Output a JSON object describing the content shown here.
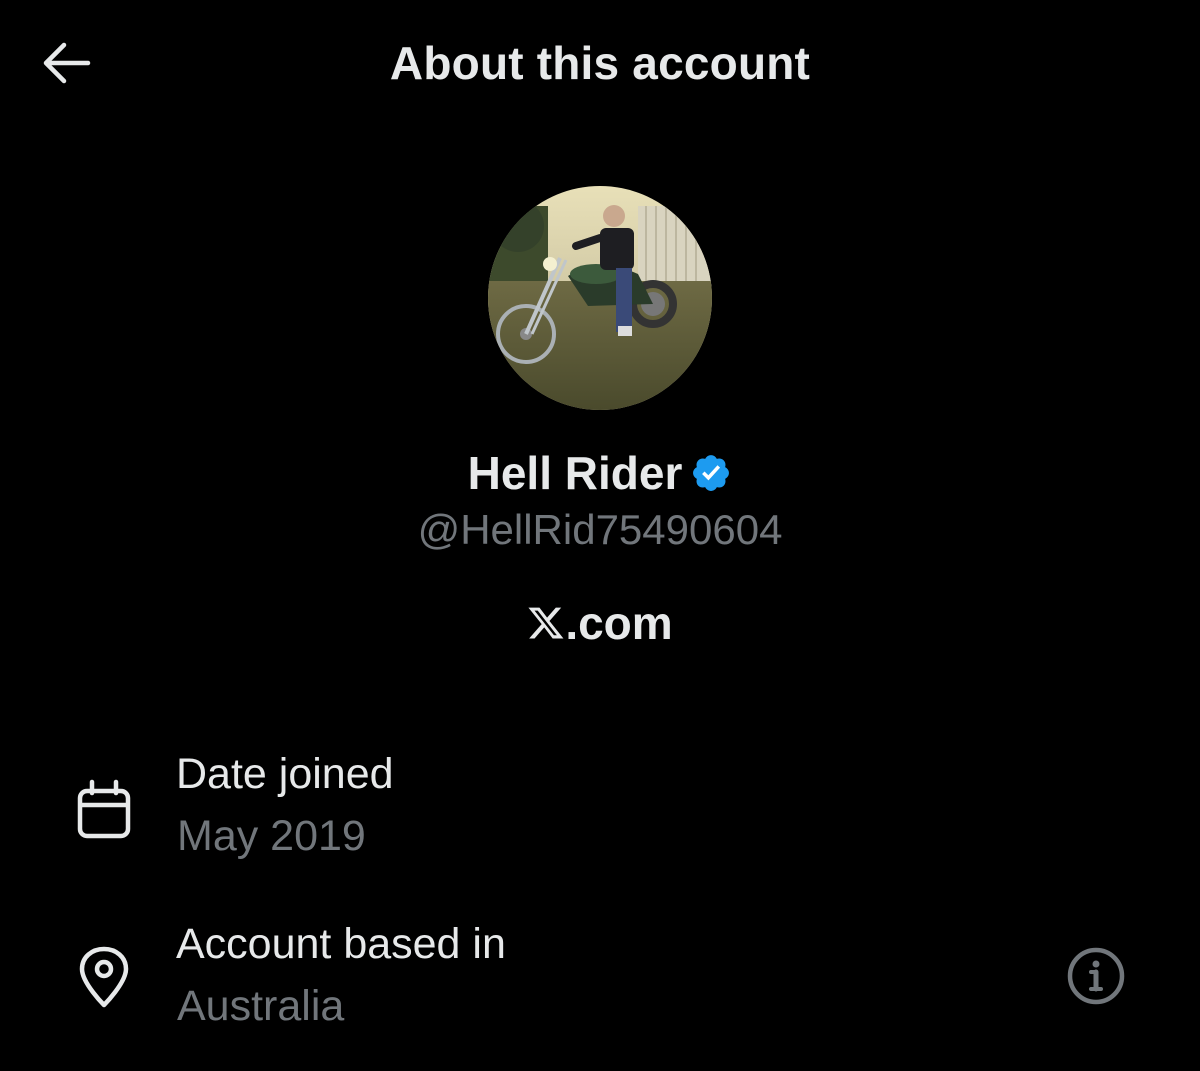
{
  "header": {
    "title": "About this account",
    "back_icon": "arrow-left-icon"
  },
  "profile": {
    "display_name": "Hell Rider",
    "handle": "@HellRid75490604",
    "verified": true,
    "verified_color": "#1d9bf0",
    "avatar_description": "avatar-photo"
  },
  "platform": {
    "text": ".com",
    "logo_icon": "x-logo-icon"
  },
  "details": {
    "date_joined": {
      "label": "Date joined",
      "value": "May 2019",
      "icon": "calendar-icon"
    },
    "account_based_in": {
      "label": "Account based in",
      "value": "Australia",
      "icon": "location-pin-icon",
      "info_icon": "info-icon"
    }
  },
  "colors": {
    "background": "#000000",
    "primary_text": "#e7e9ea",
    "secondary_text": "#71767b"
  }
}
